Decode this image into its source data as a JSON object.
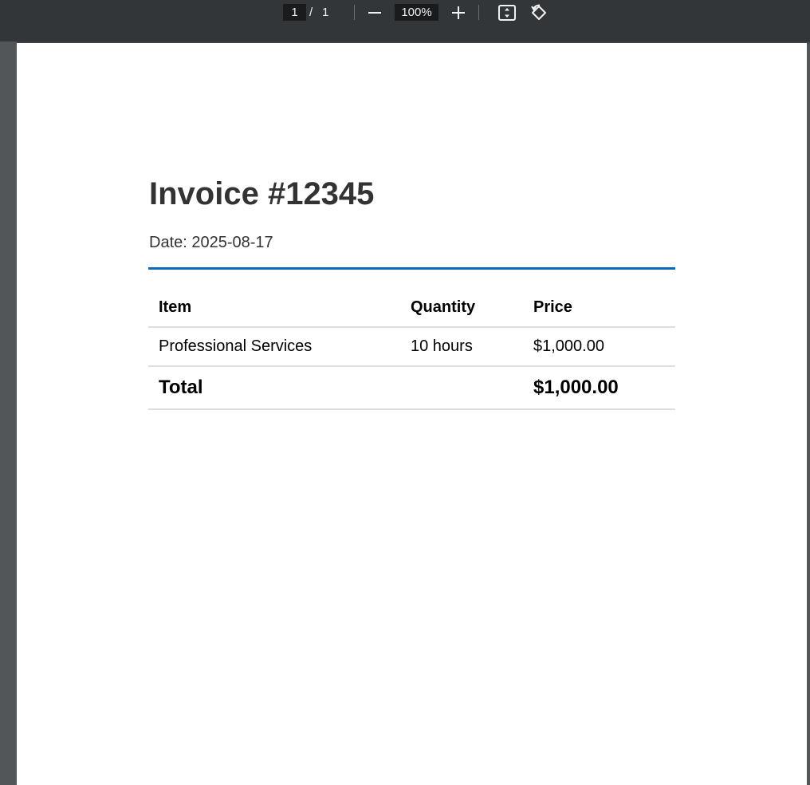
{
  "toolbar": {
    "current_page": "1",
    "page_separator": "/",
    "total_pages": "1",
    "zoom_level": "100%",
    "icons": {
      "zoom_out": "minus-icon",
      "zoom_in": "plus-icon",
      "fit_page": "fit-to-page-icon",
      "rotate": "rotate-icon"
    }
  },
  "document": {
    "title": "Invoice #12345",
    "date": "Date: 2025-08-17",
    "accent_color": "#0a6ab8",
    "table": {
      "headers": [
        "Item",
        "Quantity",
        "Price"
      ],
      "rows": [
        [
          "Professional Services",
          "10 hours",
          "$1,000.00"
        ]
      ],
      "total": {
        "label": "Total",
        "quantity": "",
        "value": "$1,000.00"
      }
    }
  }
}
